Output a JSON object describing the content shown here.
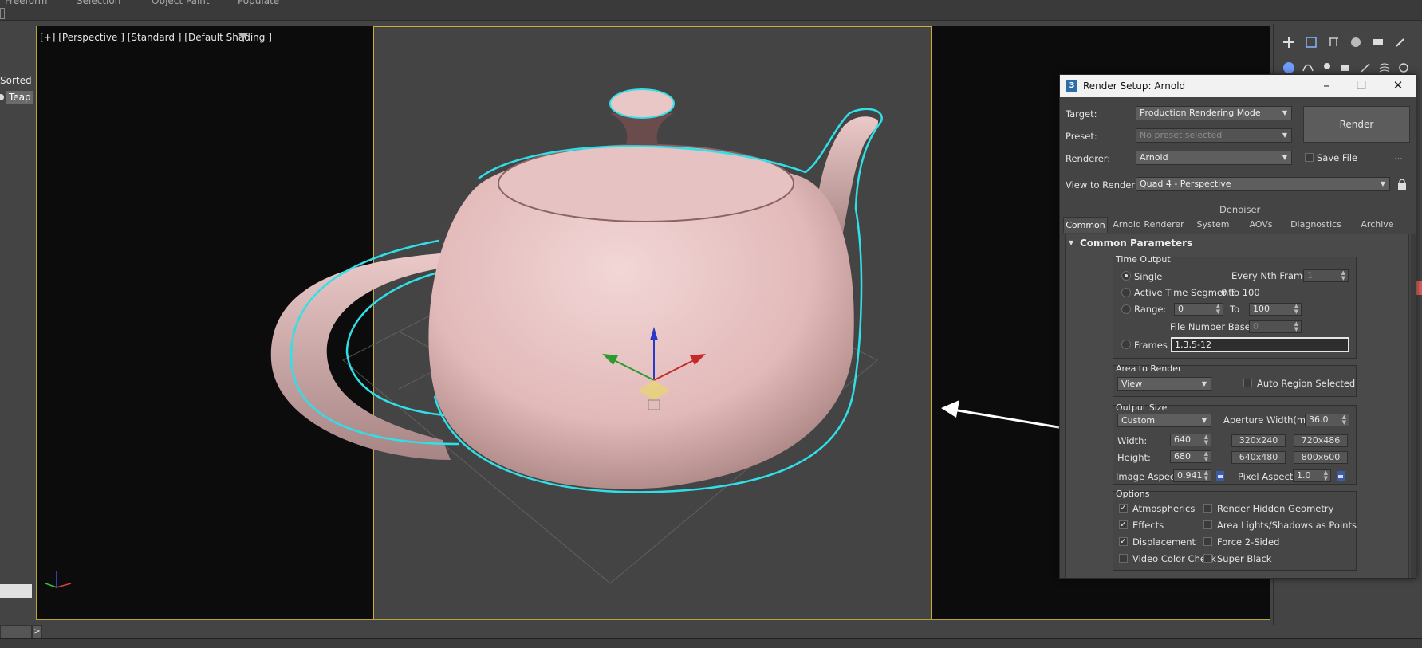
{
  "menubar": {
    "items": [
      "Freeform",
      "Selection",
      "Object Paint",
      "Populate"
    ]
  },
  "left_panel": {
    "sorted_label": "Sorted",
    "item_label": "Teap"
  },
  "bottom": {
    "expand_glyph": ">"
  },
  "viewport": {
    "label": "[+] [Perspective ] [Standard ] [Default Shading ]"
  },
  "dialog": {
    "title": "Render Setup: Arnold",
    "title_icon": "3",
    "labels": {
      "target": "Target:",
      "preset": "Preset:",
      "renderer": "Renderer:",
      "view": "View to Render:",
      "denoiser": "Denoiser"
    },
    "target_value": "Production Rendering Mode",
    "preset_value": "No preset selected",
    "renderer_value": "Arnold",
    "view_value": "Quad 4 - Perspective",
    "render_button": "Render",
    "save_file": "Save File",
    "ellipsis": "...",
    "tabs": [
      "Common",
      "Arnold Renderer",
      "System",
      "AOVs",
      "Diagnostics",
      "Archive"
    ],
    "rollout_title": "Common Parameters",
    "time_output": {
      "title": "Time Output",
      "single": "Single",
      "every_nth": "Every Nth Frame:",
      "every_nth_value": "1",
      "active_segment": "Active Time Segment:",
      "active_range": "0 To 100",
      "range": "Range:",
      "range_from": "0",
      "to": "To",
      "range_to": "100",
      "file_number_base": "File Number Base:",
      "file_number_value": "0",
      "frames": "Frames",
      "frames_value": "1,3,5-12"
    },
    "area": {
      "title": "Area to Render",
      "value": "View",
      "auto_region": "Auto Region Selected"
    },
    "output_size": {
      "title": "Output Size",
      "preset": "Custom",
      "aperture_label": "Aperture Width(mm):",
      "aperture_value": "36.0",
      "width_label": "Width:",
      "width_value": "640",
      "height_label": "Height:",
      "height_value": "680",
      "presets": [
        "320x240",
        "720x486",
        "640x480",
        "800x600"
      ],
      "image_aspect_label": "Image Aspect:",
      "image_aspect_value": "0.941",
      "pixel_aspect_label": "Pixel Aspect:",
      "pixel_aspect_value": "1.0"
    },
    "options": {
      "title": "Options",
      "atmospherics": "Atmospherics",
      "render_hidden": "Render Hidden Geometry",
      "effects": "Effects",
      "area_lights": "Area Lights/Shadows as Points",
      "displacement": "Displacement",
      "force_2sided": "Force 2-Sided",
      "video_color": "Video Color Check",
      "super_black": "Super Black"
    }
  },
  "colors": {
    "selection_outline": "#2fe0e8",
    "teapot": "#e7c4c4",
    "viewport_border": "#c9ad34"
  }
}
